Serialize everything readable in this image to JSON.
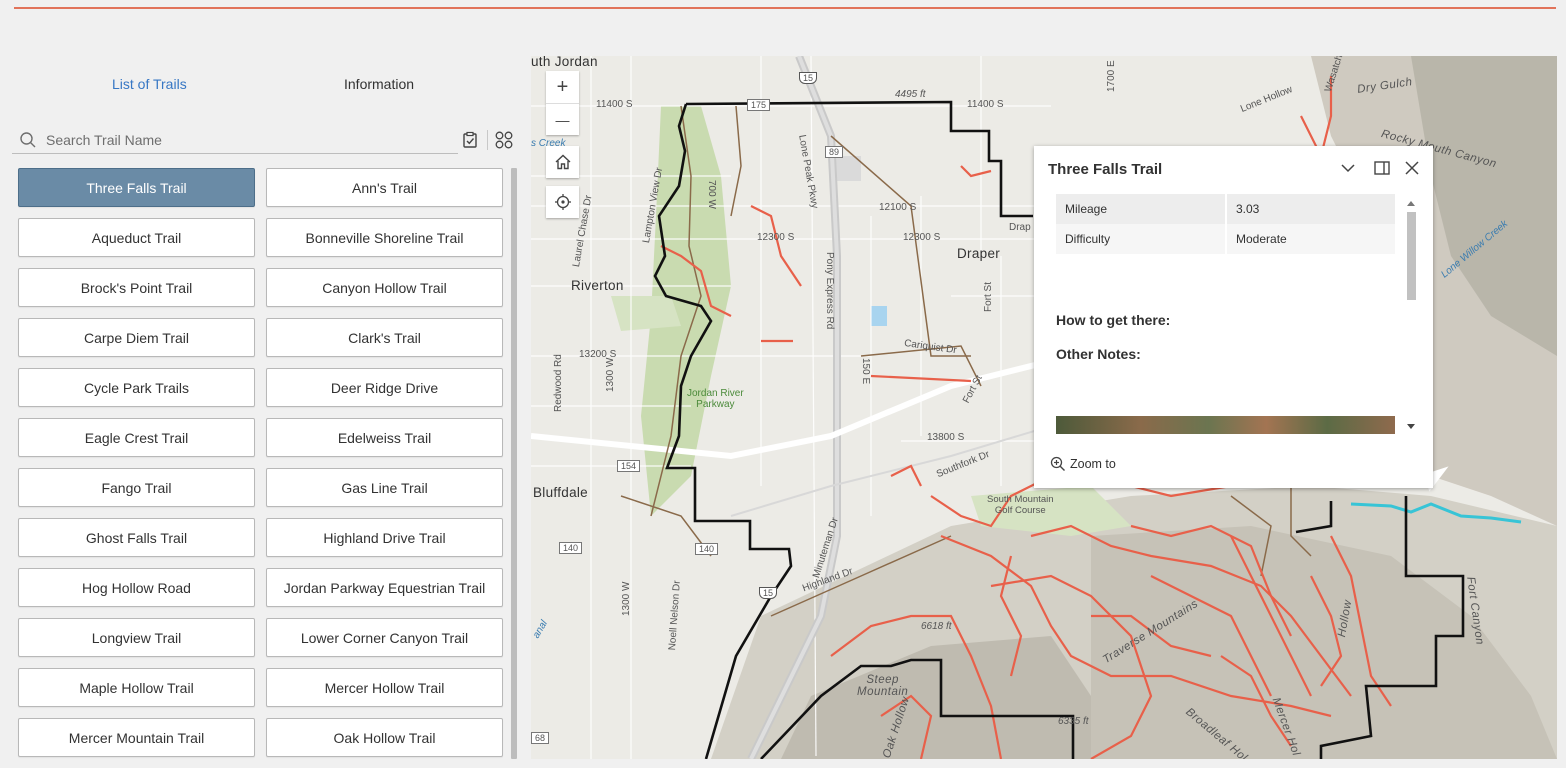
{
  "tabs": [
    {
      "label": "List of Trails",
      "active": true
    },
    {
      "label": "Information",
      "active": false
    }
  ],
  "search": {
    "placeholder": "Search Trail Name",
    "value": ""
  },
  "tools": {
    "clear_icon": "clipboard-clear-icon",
    "layout_icon": "grid-layout-icon"
  },
  "colors": {
    "accent": "#3777c4",
    "selected_bg": "#6a8ba6",
    "trail": "#e8604a",
    "boundary": "#000000",
    "highlight": "#37c4d6",
    "topline": "#e1735a"
  },
  "trails": [
    {
      "name": "Three Falls Trail",
      "selected": true
    },
    {
      "name": "Ann's Trail"
    },
    {
      "name": "Aqueduct Trail"
    },
    {
      "name": "Bonneville Shoreline Trail"
    },
    {
      "name": "Brock's Point Trail"
    },
    {
      "name": "Canyon Hollow Trail"
    },
    {
      "name": "Carpe Diem Trail"
    },
    {
      "name": "Clark's Trail"
    },
    {
      "name": "Cycle Park Trails"
    },
    {
      "name": "Deer Ridge Drive"
    },
    {
      "name": "Eagle Crest Trail"
    },
    {
      "name": "Edelweiss Trail"
    },
    {
      "name": "Fango Trail"
    },
    {
      "name": "Gas Line Trail"
    },
    {
      "name": "Ghost Falls Trail"
    },
    {
      "name": "Highland Drive Trail"
    },
    {
      "name": "Hog Hollow Road"
    },
    {
      "name": "Jordan Parkway Equestrian Trail"
    },
    {
      "name": "Longview Trail"
    },
    {
      "name": "Lower Corner Canyon Trail"
    },
    {
      "name": "Maple Hollow Trail"
    },
    {
      "name": "Mercer Hollow Trail"
    },
    {
      "name": "Mercer Mountain Trail"
    },
    {
      "name": "Oak Hollow Trail"
    }
  ],
  "map": {
    "controls": {
      "zoom_in": "+",
      "zoom_out": "—"
    },
    "labels": {
      "south_jordan": "uth Jordan",
      "riverton": "Riverton",
      "draper": "Draper",
      "bluffdale": "Bluffdale",
      "golf": "South Mountain\nGolf Course",
      "dry_gulch": "Dry Gulch",
      "rocky_mouth": "Rocky Mouth Canyon",
      "lone_hollow": "Lone Hollow",
      "jordan_parkway": "Jordan River\nParkway",
      "traverse": "Traverse Mountains",
      "steep_mountain": "Steep\nMountain",
      "oak_hollow": "Oak Hollow",
      "broadleaf": "Broadleaf Hol",
      "mercer": "Mercer Hol",
      "fort_canyon": "Fort Canyon",
      "bell_hollow": "Hollow",
      "elev1": "4495 ft",
      "elev2": "6335 ft",
      "elev3": "6618 ft",
      "r11400s_a": "11400 S",
      "r11400s_b": "11400 S",
      "r12100s": "12100 S",
      "r12300s_a": "12300 S",
      "r12300s_b": "12300 S",
      "r13200s": "13200 S",
      "r13800s": "13800 S",
      "r1700e": "1700 E",
      "r700w": "700 W",
      "r1300w_a": "1300 W",
      "r1300w_b": "1300 W",
      "redwood": "Redwood Rd",
      "laurel": "Laurel Chase Dr",
      "lampton": "Lampton View Dr",
      "lonepeak": "Lone Peak Pkwy",
      "ponyexpress": "Pony Express Rd",
      "cariquist": "Cariquist Dr",
      "fortst_a": "Fort St",
      "fortst_b": "Fort St",
      "southfork": "Southfork Dr",
      "highland": "Highland Dr",
      "minuteman": "Minuteman Dr",
      "noell": "Noell Nelson Dr",
      "wasatch": "Wasatch",
      "r150e": "150 E",
      "drap": "Drap",
      "s154": "154",
      "s140_a": "140",
      "s140_b": "140",
      "s68": "68",
      "i15_a": "15",
      "i15_b": "15",
      "s175": "175",
      "s89": "89",
      "lonecreek": "Lone Willow Creek",
      "parkway_c": "s Creek",
      "canal": "anal"
    }
  },
  "popup": {
    "title": "Three Falls Trail",
    "attributes": [
      {
        "key": "Mileage",
        "value": "3.03"
      },
      {
        "key": "Difficulty",
        "value": "Moderate"
      }
    ],
    "how_to_label": "How to get there:",
    "other_notes_label": "Other Notes:",
    "zoom_label": "Zoom to"
  }
}
